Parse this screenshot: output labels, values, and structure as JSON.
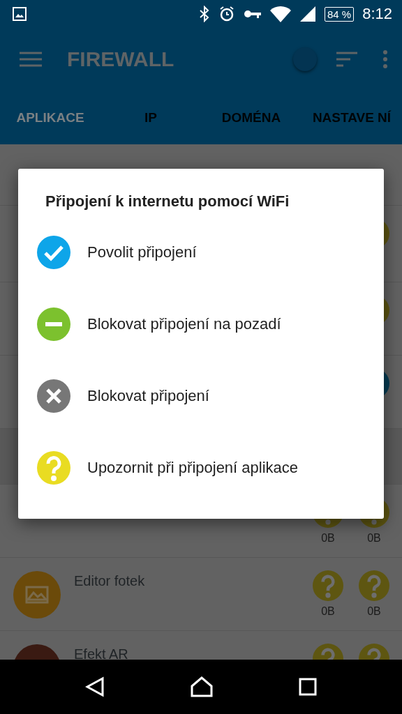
{
  "status_bar": {
    "battery": "84 %",
    "time": "8:12"
  },
  "app_bar": {
    "title": "FIREWALL",
    "firewall_on": true
  },
  "tabs": [
    {
      "label": "APLIKACE",
      "selected": true
    },
    {
      "label": "IP",
      "selected": false
    },
    {
      "label": "DOMÉNA",
      "selected": false
    },
    {
      "label": "NASTAVE NÍ",
      "selected": false
    }
  ],
  "list": {
    "rows": [
      {
        "icons": [
          {
            "kind": "ask"
          }
        ]
      },
      {
        "icons": [
          {
            "kind": "ask"
          }
        ]
      },
      {
        "icons": [
          {
            "kind": "allow"
          }
        ]
      },
      {
        "icons": [
          {
            "kind": "ask"
          },
          {
            "kind": "ask"
          }
        ],
        "traffic": [
          "0B",
          "0B"
        ]
      },
      {
        "name": "Editor fotek",
        "icons": [
          {
            "kind": "ask"
          },
          {
            "kind": "ask"
          }
        ],
        "traffic": [
          "0B",
          "0B"
        ]
      },
      {
        "name": "Efekt AR",
        "icons": [
          {
            "kind": "ask"
          },
          {
            "kind": "ask"
          }
        ]
      }
    ]
  },
  "dialog": {
    "title": "Připojení k internetu pomocí WiFi",
    "options": [
      {
        "kind": "allow",
        "label": "Povolit připojení"
      },
      {
        "kind": "block_background",
        "label": "Blokovat připojení na pozadí"
      },
      {
        "kind": "block",
        "label": "Blokovat připojení"
      },
      {
        "kind": "ask",
        "label": "Upozornit při připojení aplikace"
      }
    ]
  }
}
